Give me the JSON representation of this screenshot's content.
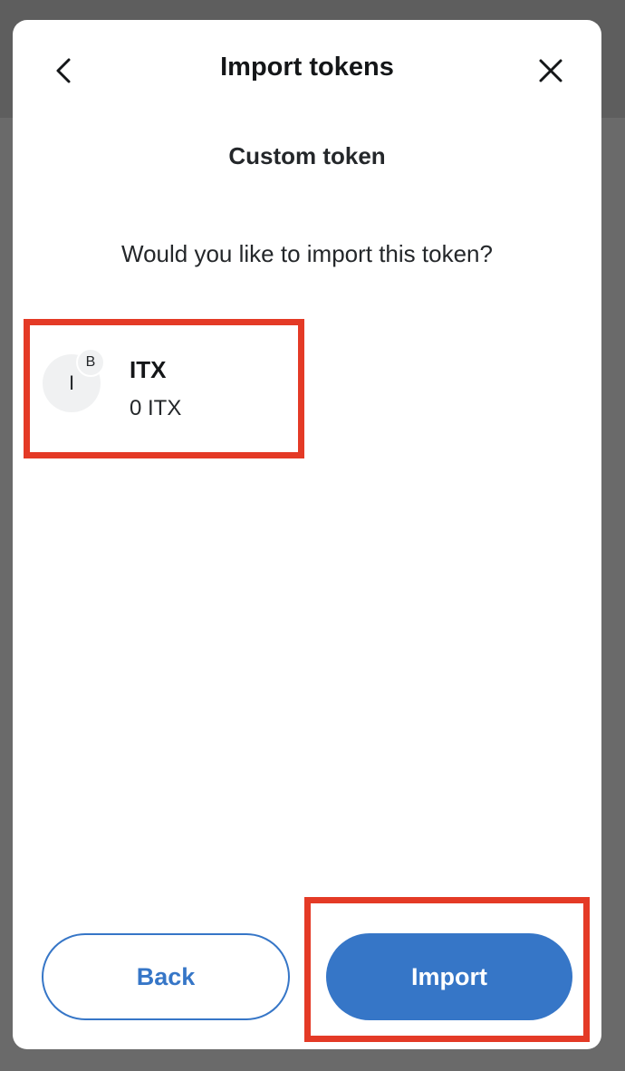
{
  "header": {
    "title": "Import tokens",
    "back_icon": "chevron-left-icon",
    "close_icon": "close-icon"
  },
  "subtitle": "Custom token",
  "question": "Would you like to import this token?",
  "token": {
    "avatar_letter": "I",
    "network_badge_letter": "B",
    "symbol": "ITX",
    "balance": "0 ITX"
  },
  "buttons": {
    "back_label": "Back",
    "import_label": "Import"
  },
  "colors": {
    "accent": "#3676c7",
    "highlight": "#e43a26",
    "text": "#24272a"
  }
}
